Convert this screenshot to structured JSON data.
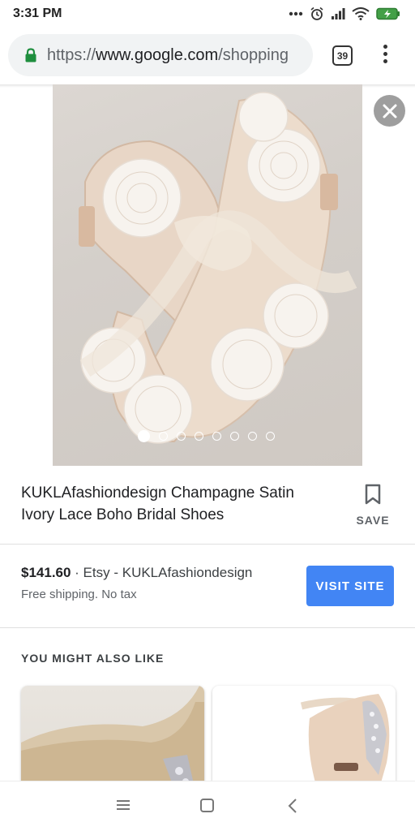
{
  "status_bar": {
    "time": "3:31 PM",
    "icons": [
      "more-dots-icon",
      "alarm-icon",
      "signal-icon",
      "wifi-icon",
      "battery-charging-icon"
    ]
  },
  "browser": {
    "url_scheme": "https://",
    "url_domain": "www.google.com",
    "url_path": "/shopping",
    "tab_count": "39",
    "icons": [
      "lock-icon",
      "tab-switcher-icon",
      "overflow-menu-icon"
    ]
  },
  "product": {
    "image_alt_icon": "bridal-shoes-photo",
    "carousel": {
      "count": 8,
      "active_index": 0
    },
    "title": "KUKLAfashiondesign Champagne Satin Ivory Lace Boho Bridal Shoes",
    "save_label": "SAVE",
    "price": "$141.60",
    "seller": " · Etsy - KUKLAfashiondesign",
    "shipping": "Free shipping. No tax",
    "visit_label": "VISIT SITE"
  },
  "recommendations": {
    "heading": "YOU MIGHT ALSO LIKE",
    "items": [
      "glitter-pump-photo",
      "ankle-strap-heel-photo"
    ]
  },
  "nav": {
    "icons": [
      "recents-icon",
      "home-icon",
      "back-icon"
    ]
  },
  "colors": {
    "accent": "#4285f4",
    "lock_green": "#1e8e3e"
  }
}
